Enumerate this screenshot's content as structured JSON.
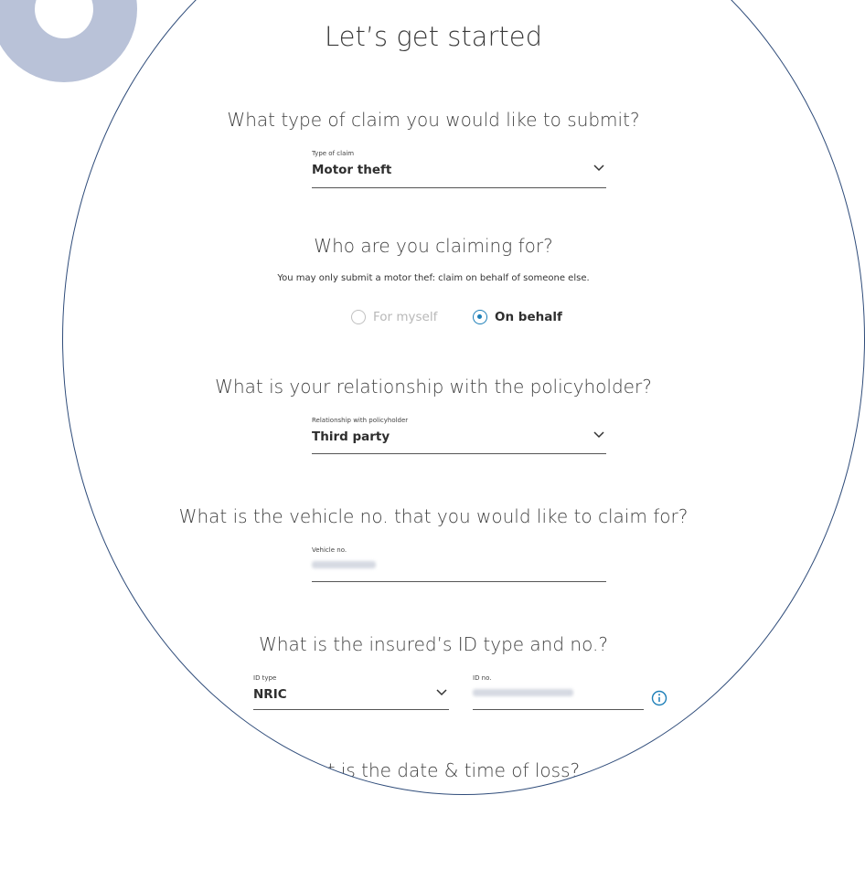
{
  "page": {
    "title": "Let’s get started"
  },
  "claim_type": {
    "question": "What type of claim you would like to submit?",
    "label": "Type of claim",
    "value": "Motor theft"
  },
  "claimant": {
    "question": "Who are you claiming for?",
    "note": "You may only submit a motor thef: claim on behalf of someone else.",
    "options": [
      {
        "label": "For myself",
        "selected": false,
        "disabled": true
      },
      {
        "label": "On behalf",
        "selected": true,
        "disabled": false
      }
    ]
  },
  "relationship": {
    "question": "What is your relationship with the policyholder?",
    "label": "Relationship with policyholder",
    "value": "Third party"
  },
  "vehicle": {
    "question": "What is the vehicle no. that you would like to claim for?",
    "label": "Vehicle no."
  },
  "insured_id": {
    "question": "What is the insured’s ID type and no.?",
    "type_label": "ID type",
    "type_value": "NRIC",
    "no_label": "ID no."
  },
  "loss": {
    "question": "What is the date & time of loss?"
  },
  "colors": {
    "accent": "#1d7fb8",
    "circle_border": "#2f4c7a",
    "decoration": "#b9c2d8"
  },
  "icons": [
    "chevron-down-icon",
    "radio-icon",
    "info-icon"
  ]
}
